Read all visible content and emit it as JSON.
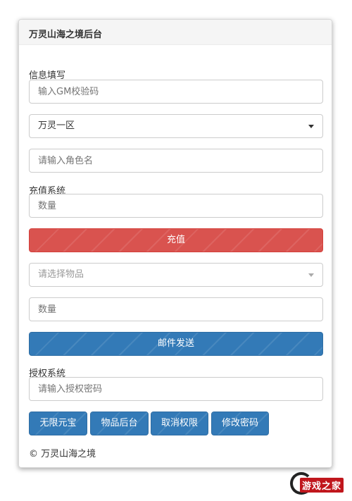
{
  "panel": {
    "title": "万灵山海之境后台"
  },
  "info_section": {
    "label": "信息填写",
    "gm_code_placeholder": "输入GM校验码",
    "server_selected": "万灵一区",
    "role_name_placeholder": "请输入角色名"
  },
  "recharge_section": {
    "label": "充值系统",
    "amount_placeholder": "数量",
    "recharge_button": "充值"
  },
  "mail_section": {
    "item_select_placeholder": "请选择物品",
    "quantity_placeholder": "数量",
    "send_button": "邮件发送"
  },
  "auth_section": {
    "label": "授权系统",
    "password_placeholder": "请输入授权密码",
    "buttons": [
      "无限元宝",
      "物品后台",
      "取消权限",
      "修改密码"
    ]
  },
  "footer": {
    "text": "© 万灵山海之境"
  },
  "watermark": {
    "text": "游戏之家"
  },
  "colors": {
    "danger": "#d9534f",
    "primary": "#337ab7",
    "watermark_red": "#c0161c"
  }
}
